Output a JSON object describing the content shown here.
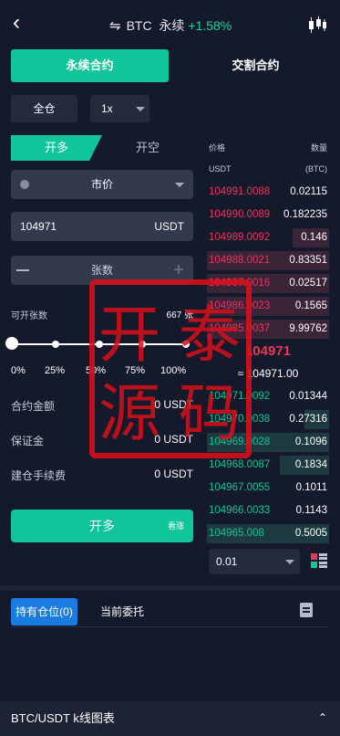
{
  "header": {
    "back_icon": "chevron-left-icon",
    "swap_icon": "swap-icon",
    "symbol": "BTC",
    "contract_kind": "永续",
    "change_pct": "+1.58%",
    "chart_icon": "candlestick-icon"
  },
  "contract_tabs": [
    "永续合约",
    "交割合约"
  ],
  "margin_mode": "全仓",
  "leverage": "1x",
  "side_tabs": {
    "open": "开多",
    "close": "开空"
  },
  "order_type": "市价",
  "price_input": {
    "value": "104971",
    "unit": "USDT"
  },
  "quantity_input": {
    "placeholder": "张数"
  },
  "available": {
    "label": "可开张数",
    "value": "667 张"
  },
  "slider": {
    "level": 0,
    "ticks": [
      "0%",
      "25%",
      "50%",
      "75%",
      "100%"
    ]
  },
  "info": {
    "contract_amount": {
      "label": "合约金额",
      "value": "0 USDT"
    },
    "margin": {
      "label": "保证金",
      "value": "0 USDT"
    },
    "open_fee": {
      "label": "建仓手续费",
      "value": "0 USDT"
    }
  },
  "open_button": {
    "label": "开多",
    "tag": "看涨"
  },
  "orderbook": {
    "col_price": "价格",
    "col_qty": "数量",
    "unit_price": "USDT",
    "unit_qty": "(BTC)",
    "asks": [
      {
        "price": "104991.0088",
        "qty": "0.02115",
        "depth": 0.0
      },
      {
        "price": "104990.0089",
        "qty": "0.182235",
        "depth": 0.0
      },
      {
        "price": "104989.0092",
        "qty": "0.146",
        "depth": 0.3
      },
      {
        "price": "104988.0021",
        "qty": "0.83351",
        "depth": 1.0
      },
      {
        "price": "104987.0016",
        "qty": "0.02517",
        "depth": 1.0
      },
      {
        "price": "104986.0023",
        "qty": "0.1565",
        "depth": 1.0
      },
      {
        "price": "104985.0037",
        "qty": "9.99762",
        "depth": 1.0
      }
    ],
    "last_price": "104971",
    "mark_price": "≈ 104971.00",
    "bids": [
      {
        "price": "104971.0092",
        "qty": "0.01344",
        "depth": 0.0
      },
      {
        "price": "104970.0038",
        "qty": "0.27316",
        "depth": 0.2
      },
      {
        "price": "104969.0028",
        "qty": "0.1096",
        "depth": 1.0
      },
      {
        "price": "104968.0087",
        "qty": "0.1834",
        "depth": 0.4
      },
      {
        "price": "104967.0055",
        "qty": "0.1011",
        "depth": 0.0
      },
      {
        "price": "104966.0033",
        "qty": "0.1143",
        "depth": 0.0
      },
      {
        "price": "104965.008",
        "qty": "0.5005",
        "depth": 1.0
      }
    ],
    "precision": "0.01"
  },
  "position_tabs": [
    "持有仓位(0)",
    "当前委托"
  ],
  "kline_bar": {
    "label": "BTC/USDT  k线图表"
  },
  "watermark": {
    "chars": [
      "开",
      "泰",
      "源",
      "码"
    ]
  },
  "colors": {
    "accent": "#11c59a",
    "ask": "#e8365c",
    "bid": "#15c393",
    "tab_blue": "#1a7ce0",
    "background": "#141a2c"
  }
}
